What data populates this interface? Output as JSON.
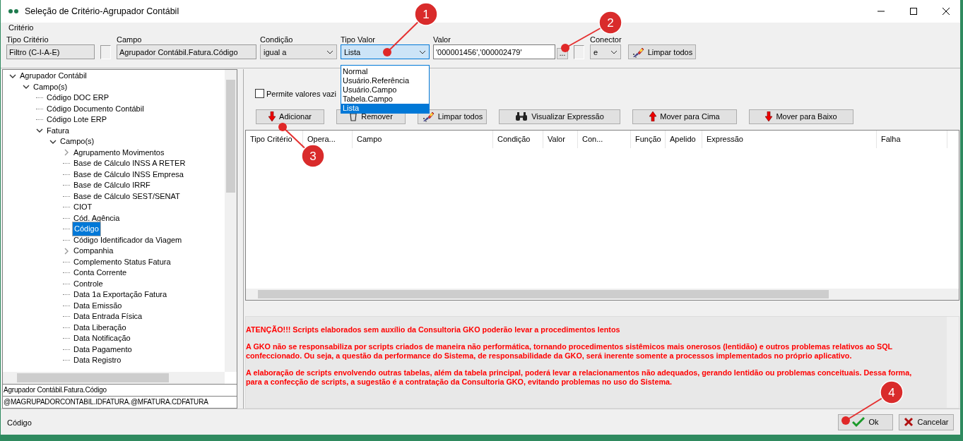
{
  "window": {
    "title": "Seleção de Critério-Agrupador Contábil"
  },
  "criteria": {
    "legend": "Critério",
    "tipo_criterio": {
      "label": "Tipo Critério",
      "value": "Filtro (C-I-A-E)"
    },
    "lock": {
      "checked": false
    },
    "campo": {
      "label": "Campo",
      "value": "Agrupador Contábil.Fatura.Código"
    },
    "condicao": {
      "label": "Condição",
      "value": "igual a"
    },
    "tipo_valor": {
      "label": "Tipo Valor",
      "value": "Lista",
      "expanded": true,
      "options": [
        {
          "label": "Normal",
          "selected": false
        },
        {
          "label": "Usuário.Referência",
          "selected": false
        },
        {
          "label": "Usuário.Campo",
          "selected": false
        },
        {
          "label": "Tabela.Campo",
          "selected": false
        },
        {
          "label": "Lista",
          "selected": true
        }
      ]
    },
    "valor": {
      "label": "Valor",
      "value": "'000001456','000002479'",
      "browse": "..."
    },
    "valor_check": {
      "checked": false
    },
    "conector": {
      "label": "Conector",
      "value": "e"
    },
    "clear_button": "Limpar todos"
  },
  "tree": [
    {
      "label": "Agrupador Contábil",
      "expanded": true,
      "selected": false,
      "children": [
        {
          "label": "Campo(s)",
          "expanded": true,
          "selected": false,
          "children": [
            {
              "label": "Código DOC ERP",
              "selected": false
            },
            {
              "label": "Código Documento Contábil",
              "selected": false
            },
            {
              "label": "Código Lote ERP",
              "selected": false
            },
            {
              "label": "Fatura",
              "expanded": true,
              "selected": false,
              "children": [
                {
                  "label": "Campo(s)",
                  "expanded": true,
                  "selected": false,
                  "children": [
                    {
                      "label": "Agrupamento Movimentos",
                      "expanded": false,
                      "selected": false
                    },
                    {
                      "label": "Base de Cálculo INSS A RETER",
                      "selected": false
                    },
                    {
                      "label": "Base de Cálculo INSS Empresa",
                      "selected": false
                    },
                    {
                      "label": "Base de Cálculo IRRF",
                      "selected": false
                    },
                    {
                      "label": "Base de Cálculo SEST/SENAT",
                      "selected": false
                    },
                    {
                      "label": "CIOT",
                      "selected": false
                    },
                    {
                      "label": "Cód. Agência",
                      "selected": false
                    },
                    {
                      "label": "Código",
                      "selected": true
                    },
                    {
                      "label": "Código Identificador da Viagem",
                      "selected": false
                    },
                    {
                      "label": "Companhia",
                      "expanded": false,
                      "selected": false
                    },
                    {
                      "label": "Complemento Status Fatura",
                      "selected": false
                    },
                    {
                      "label": "Conta Corrente",
                      "selected": false
                    },
                    {
                      "label": "Controle",
                      "selected": false
                    },
                    {
                      "label": "Data 1a Exportação Fatura",
                      "selected": false
                    },
                    {
                      "label": "Data Emissão",
                      "selected": false
                    },
                    {
                      "label": "Data Entrada Física",
                      "selected": false
                    },
                    {
                      "label": "Data Liberação",
                      "selected": false
                    },
                    {
                      "label": "Data Notificação",
                      "selected": false
                    },
                    {
                      "label": "Data Pagamento",
                      "selected": false
                    },
                    {
                      "label": "Data Registro",
                      "selected": false
                    }
                  ]
                }
              ]
            }
          ]
        }
      ]
    }
  ],
  "path_lines": [
    "Agrupador Contábil.Fatura.Código",
    "@MAGRUPADORCONTABIL.IDFATURA.@MFATURA.CDFATURA"
  ],
  "allow_empty": {
    "label": "Permite valores vazi",
    "checked": false
  },
  "toolbar": [
    {
      "kind": "add",
      "label": "Adicionar"
    },
    {
      "kind": "remove",
      "label": "Remover"
    },
    {
      "kind": "clear",
      "label": "Limpar todos"
    },
    {
      "kind": "view",
      "label": "Visualizar Expressão"
    },
    {
      "kind": "up",
      "label": "Mover para Cima"
    },
    {
      "kind": "down",
      "label": "Mover para Baixo"
    }
  ],
  "grid": {
    "columns": [
      "Tipo Critério",
      "Opera...",
      "Campo",
      "Condição",
      "Valor",
      "Con...",
      "Função",
      "Apelido",
      "Expressão",
      "Falha"
    ]
  },
  "warning": [
    "ATENÇÃO!!! Scripts elaborados sem auxílio da Consultoria GKO poderão levar a procedimentos lentos",
    "A GKO não se responsabiliza por scripts criados de maneira não performática, tornando procedimentos sistêmicos mais onerosos (lentidão) e outros problemas relativos ao SQL confeccionado. Ou seja, a questão da performance do Sistema, de responsabilidade da GKO, será inerente somente a processos implementados no próprio aplicativo.",
    "A elaboração de scripts envolvendo outras tabelas, além da tabela principal, poderá levar a relacionamentos não adequados, gerando lentidão ou problemas conceituais. Dessa forma, para a confecção de scripts, a sugestão é a contratação da Consultoria GKO, evitando problemas no uso do Sistema."
  ],
  "status": "Código",
  "buttons": [
    {
      "kind": "ok",
      "label": "Ok"
    },
    {
      "kind": "cancel",
      "label": "Cancelar"
    }
  ],
  "annotations": [
    {
      "number": "1"
    },
    {
      "number": "2"
    },
    {
      "number": "3"
    },
    {
      "number": "4"
    }
  ]
}
